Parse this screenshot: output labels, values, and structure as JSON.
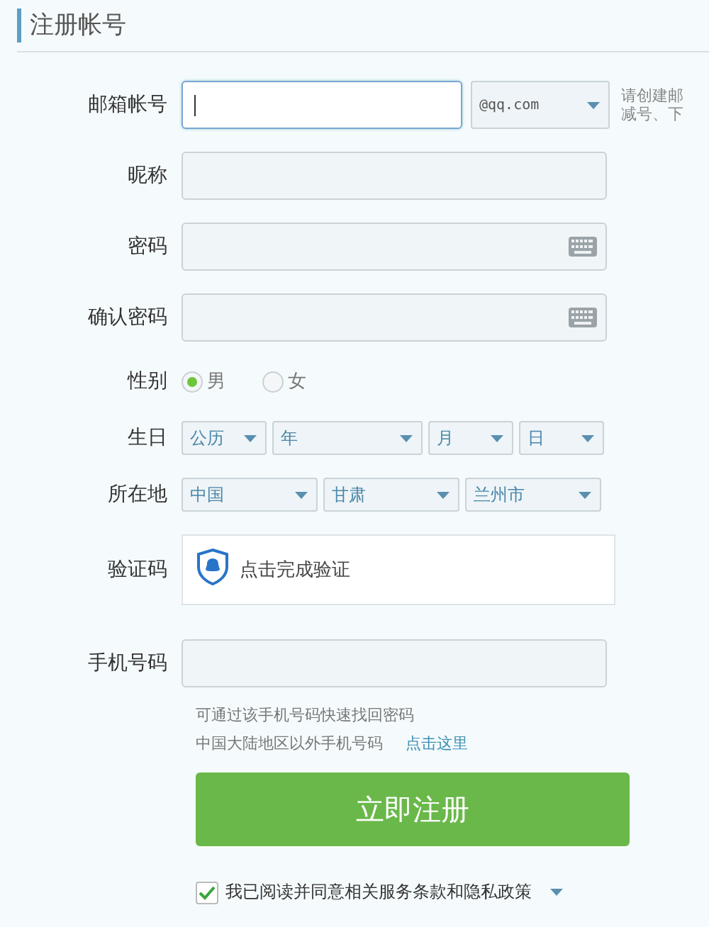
{
  "title": "注册帐号",
  "email": {
    "label": "邮箱帐号",
    "domain": "@qq.com",
    "hint_lines": [
      "请创建邮",
      "减号、下"
    ]
  },
  "nickname": {
    "label": "昵称"
  },
  "password": {
    "label": "密码"
  },
  "confirm_password": {
    "label": "确认密码"
  },
  "gender": {
    "label": "性别",
    "options": [
      {
        "label": "男",
        "selected": true
      },
      {
        "label": "女",
        "selected": false
      }
    ]
  },
  "birthday": {
    "label": "生日",
    "selects": [
      {
        "value": "公历"
      },
      {
        "value": "年"
      },
      {
        "value": "月"
      },
      {
        "value": "日"
      }
    ]
  },
  "location": {
    "label": "所在地",
    "selects": [
      {
        "value": "中国"
      },
      {
        "value": "甘肃"
      },
      {
        "value": "兰州市"
      }
    ]
  },
  "captcha": {
    "label": "验证码",
    "text": "点击完成验证"
  },
  "phone": {
    "label": "手机号码",
    "help": "可通过该手机号码快速找回密码",
    "abroad": "中国大陆地区以外手机号码",
    "abroad_link": "点击这里"
  },
  "submit": "立即注册",
  "agreement": {
    "text": "我已阅读并同意相关服务条款和隐私政策",
    "checked": true
  }
}
